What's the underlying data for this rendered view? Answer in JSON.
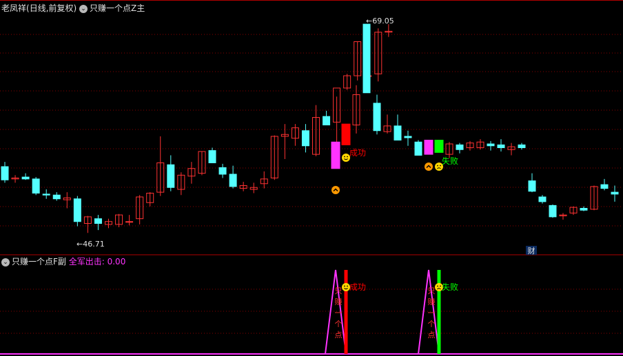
{
  "main_panel": {
    "stock_name": "老凤祥",
    "period_label": "(日线,前复权)",
    "indicator_label": "只赚一个点Z主"
  },
  "sub_panel": {
    "indicator_label": "只赚一个点F副",
    "value_label": "全军出击:",
    "value": "0.00"
  },
  "annotations": {
    "high_price": "69.05",
    "low_price": "46.71",
    "success": "成功",
    "fail": "失败",
    "finance_marker": "财",
    "vertical_text": "只赚一个点"
  },
  "colors": {
    "up": "#ff3232",
    "down": "#54ffff",
    "signal_magenta": "#ff33ff",
    "signal_red": "#ff0000",
    "signal_green": "#00ff00",
    "grid": "#8b0000",
    "indicator_line": "#ff33ff",
    "smiley": "#ffd700",
    "buy_marker": "#ff9900"
  },
  "chart_data": [
    {
      "type": "candlestick",
      "title": "老凤祥 (日线,前复权)",
      "series": [
        {
          "name": "只赚一个点Z主",
          "ohlc": [
            [
              54.0,
              54.5,
              52.3,
              52.6
            ],
            [
              52.7,
              53.1,
              52.3,
              52.8
            ],
            [
              52.9,
              53.3,
              52.6,
              52.7
            ],
            [
              52.7,
              52.9,
              51.0,
              51.2
            ],
            [
              51.1,
              51.6,
              50.6,
              51.0
            ],
            [
              51.0,
              51.3,
              50.4,
              50.6
            ],
            [
              50.5,
              51.3,
              49.6,
              50.7
            ],
            [
              50.6,
              50.9,
              47.7,
              48.2
            ],
            [
              48.0,
              48.8,
              47.0,
              48.7
            ],
            [
              48.5,
              48.9,
              47.3,
              48.0
            ],
            [
              47.9,
              48.5,
              47.5,
              48.2
            ],
            [
              47.9,
              49.0,
              47.6,
              48.9
            ],
            [
              48.2,
              48.9,
              47.8,
              48.2
            ],
            [
              48.5,
              51.0,
              47.9,
              50.8
            ],
            [
              50.2,
              51.3,
              49.8,
              51.2
            ],
            [
              51.3,
              57.2,
              50.9,
              54.4
            ],
            [
              54.2,
              55.2,
              51.4,
              51.8
            ],
            [
              51.6,
              53.4,
              51.0,
              53.1
            ],
            [
              53.0,
              54.5,
              52.2,
              53.8
            ],
            [
              53.3,
              55.6,
              53.1,
              55.6
            ],
            [
              55.7,
              56.0,
              54.4,
              54.4
            ],
            [
              53.9,
              54.3,
              52.8,
              53.2
            ],
            [
              53.2,
              54.1,
              51.7,
              51.9
            ],
            [
              51.7,
              52.4,
              51.4,
              52.0
            ],
            [
              51.6,
              52.3,
              51.2,
              51.8
            ],
            [
              52.2,
              53.5,
              51.7,
              52.7
            ],
            [
              52.8,
              57.3,
              52.6,
              57.2
            ],
            [
              57.2,
              58.5,
              54.8,
              57.4
            ],
            [
              57.0,
              58.5,
              56.2,
              58.1
            ],
            [
              57.8,
              58.5,
              55.5,
              56.2
            ],
            [
              55.3,
              60.5,
              55.1,
              59.2
            ],
            [
              59.3,
              59.9,
              58.4,
              58.4
            ],
            [
              58.7,
              61.4,
              55.4,
              62.3
            ],
            [
              62.3,
              63.8,
              62.1,
              63.6
            ],
            [
              63.6,
              67.2,
              63.1,
              67.2
            ],
            [
              63.6,
              66.2,
              63.1,
              63.6
            ],
            [
              63.8,
              68.6,
              63.0,
              68.2
            ],
            [
              68.2,
              69.05,
              67.7,
              68.3
            ]
          ]
        }
      ]
    },
    {
      "type": "line",
      "title": "只赚一个点F副",
      "series": [
        {
          "name": "全军出击",
          "values": [
            0,
            0,
            0,
            0,
            0,
            0,
            0,
            0,
            0,
            0,
            0,
            0,
            0,
            0,
            0,
            0,
            0,
            0,
            0,
            0,
            0,
            0,
            0,
            0,
            0,
            0,
            0,
            0,
            0,
            0,
            0,
            1,
            1,
            0,
            0,
            0,
            0,
            0,
            0,
            0,
            1,
            1,
            0,
            0,
            0,
            0,
            0,
            0,
            0,
            0,
            0,
            0,
            0,
            0,
            0,
            0,
            0,
            0,
            0,
            0
          ]
        }
      ]
    }
  ]
}
